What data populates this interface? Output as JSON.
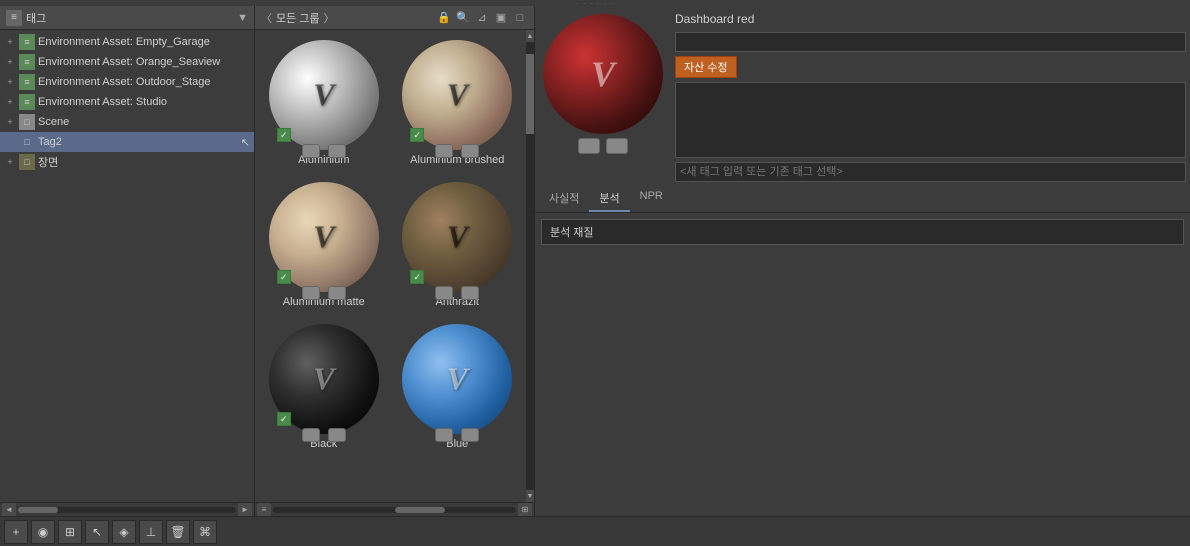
{
  "topHandle": "· · · · · ·",
  "leftPanel": {
    "header": "태그",
    "treeItems": [
      {
        "id": "env-garage",
        "label": "Environment Asset: Empty_Garage",
        "type": "env",
        "indent": 1
      },
      {
        "id": "env-orange",
        "label": "Environment Asset: Orange_Seaview",
        "type": "env",
        "indent": 1
      },
      {
        "id": "env-outdoor",
        "label": "Environment Asset: Outdoor_Stage",
        "type": "env",
        "indent": 1
      },
      {
        "id": "env-studio",
        "label": "Environment Asset: Studio",
        "type": "env",
        "indent": 1
      },
      {
        "id": "scene",
        "label": "Scene",
        "type": "scene",
        "indent": 0
      },
      {
        "id": "tag2",
        "label": "Tag2",
        "type": "tag",
        "indent": 1,
        "selected": true
      },
      {
        "id": "jangmyeon",
        "label": "장면",
        "type": "folder",
        "indent": 0
      }
    ]
  },
  "middlePanel": {
    "header": "모든 그룹",
    "lockIcon": "🔒",
    "searchIcon": "🔍",
    "filterIcon": "▼",
    "materials": [
      {
        "id": "aluminium",
        "name": "Aluminium",
        "type": "aluminium",
        "hasCheck": true
      },
      {
        "id": "aluminium-brushed",
        "name": "Aluminium brushed",
        "type": "aluminium-brushed",
        "hasCheck": true
      },
      {
        "id": "aluminium-matte",
        "name": "Aluminium matte",
        "type": "aluminium-matte",
        "hasCheck": true
      },
      {
        "id": "anthrazit",
        "name": "Anthrazit",
        "type": "anthrazit",
        "hasCheck": true
      },
      {
        "id": "black",
        "name": "Black",
        "type": "black",
        "hasCheck": true
      },
      {
        "id": "blue",
        "name": "Blue",
        "type": "blue",
        "hasCheck": false
      }
    ],
    "gridViewBtn": "⊞"
  },
  "rightPanel": {
    "title": "Dashboard red",
    "saveBtn": "자산 수정",
    "textarea": "",
    "tagPlaceholder": "<새 태그 입력 또는 기존 태그 선택>",
    "tabs": [
      {
        "id": "facts",
        "label": "사실적",
        "active": false
      },
      {
        "id": "analysis",
        "label": "분석",
        "active": true
      },
      {
        "id": "npr",
        "label": "NPR",
        "active": false
      }
    ],
    "analysisLabel": "분석 재질"
  },
  "bottomToolbar": {
    "buttons": [
      {
        "id": "add",
        "icon": "+"
      },
      {
        "id": "circle-dot",
        "icon": "◉"
      },
      {
        "id": "grid",
        "icon": "⊞"
      },
      {
        "id": "pointer",
        "icon": "↖"
      },
      {
        "id": "paint",
        "icon": "◈"
      },
      {
        "id": "floor",
        "icon": "⊥"
      },
      {
        "id": "delete",
        "icon": "🗑"
      },
      {
        "id": "link",
        "icon": "⌘"
      }
    ]
  }
}
